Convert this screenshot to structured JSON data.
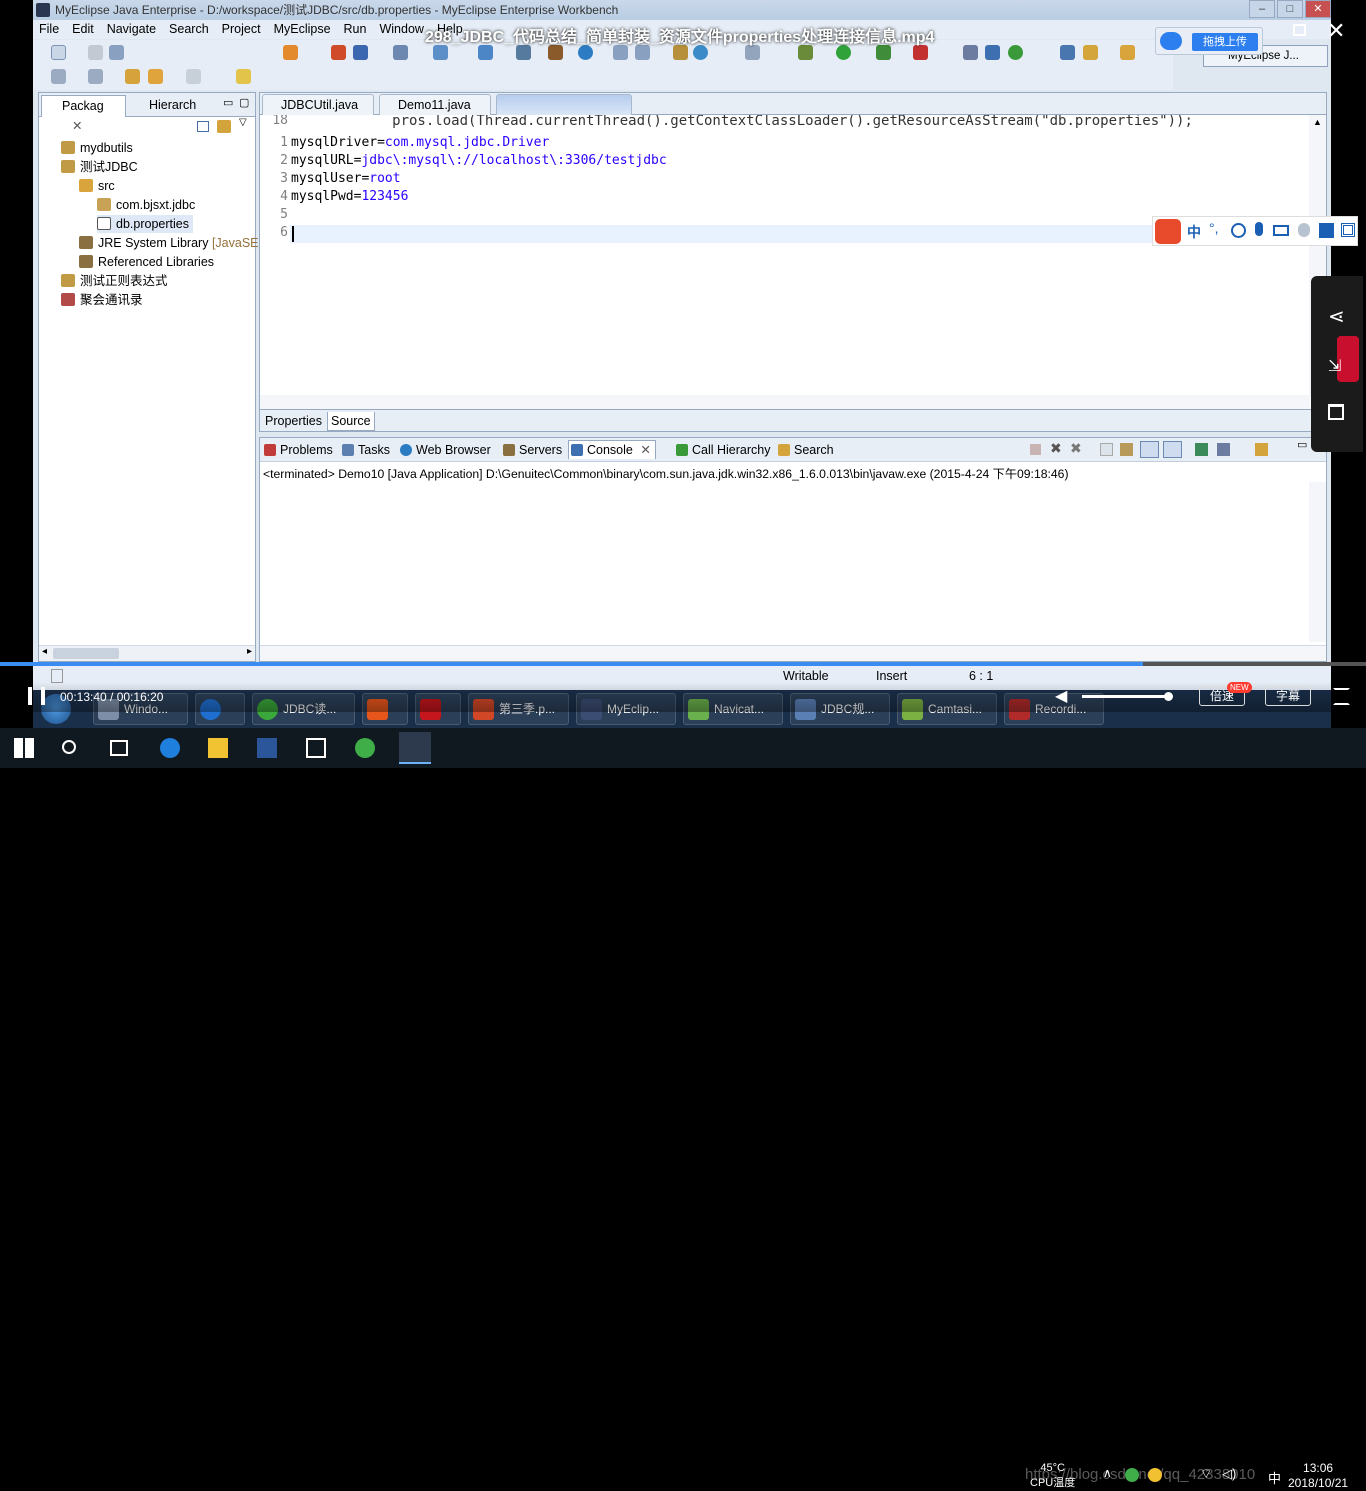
{
  "video": {
    "title": "298_JDBC_代码总结_简单封装_资源文件properties处理连接信息.mp4",
    "time": "00:13:40 / 00:16:20",
    "progress": 0.837,
    "speed_label": "倍速",
    "speed_badge": "NEW",
    "subtitle_label": "字幕",
    "upload_label": "拖拽上传"
  },
  "window": {
    "title": "MyEclipse Java Enterprise - D:/workspace/测试JDBC/src/db.properties - MyEclipse Enterprise Workbench",
    "perspective": "MyEclipse J..."
  },
  "menu": [
    "File",
    "Edit",
    "Navigate",
    "Search",
    "Project",
    "MyEclipse",
    "Run",
    "Window",
    "Help"
  ],
  "left_panel": {
    "tabs": [
      "Packag",
      "Hierarch"
    ],
    "tree": [
      {
        "label": "mydbutils",
        "level": 1
      },
      {
        "label": "测试JDBC",
        "level": 1
      },
      {
        "label": "src",
        "level": 2
      },
      {
        "label": "com.bjsxt.jdbc",
        "level": 3
      },
      {
        "label": "db.properties",
        "level": 3
      },
      {
        "label": "JRE System Library",
        "suffix": "[JavaSE-",
        "level": 2
      },
      {
        "label": "Referenced Libraries",
        "level": 2
      },
      {
        "label": "测试正则表达式",
        "level": 1
      },
      {
        "label": "聚会通讯录",
        "level": 1
      }
    ]
  },
  "editor": {
    "tabs": [
      "JDBCUtil.java",
      "Demo11.java"
    ],
    "ghost_line_no": "18",
    "ghost_line": "            pros.load(Thread.currentThread().getContextClassLoader().getResourceAsStream(\"db.properties\"));",
    "lines": [
      {
        "no": "1",
        "key": "mysqlDriver",
        "value": "com.mysql.jdbc.Driver"
      },
      {
        "no": "2",
        "key": "mysqlURL",
        "value": "jdbc\\:mysql\\://localhost\\:3306/testjdbc"
      },
      {
        "no": "3",
        "key": "mysqlUser",
        "value": "root"
      },
      {
        "no": "4",
        "key": "mysqlPwd",
        "value": "123456"
      },
      {
        "no": "5",
        "key": "",
        "value": ""
      },
      {
        "no": "6",
        "key": "",
        "value": ""
      }
    ],
    "bottom_tabs": [
      "Properties",
      "Source"
    ]
  },
  "console": {
    "tabs": [
      "Problems",
      "Tasks",
      "Web Browser",
      "Servers",
      "Console",
      "Call Hierarchy",
      "Search"
    ],
    "message": "<terminated> Demo10 [Java Application] D:\\Genuitec\\Common\\binary\\com.sun.java.jdk.win32.x86_1.6.0.013\\bin\\javaw.exe (2015-4-24 下午09:18:46)"
  },
  "status": {
    "writable": "Writable",
    "insert": "Insert",
    "position": "6 : 1"
  },
  "old_taskbar": [
    {
      "label": "Windo...",
      "color": "#7d8ea8"
    },
    {
      "label": "",
      "color": "#1f6fd1"
    },
    {
      "label": "JDBC读...",
      "color": "#3aa83a"
    },
    {
      "label": "",
      "color": "#e8561b"
    },
    {
      "label": "",
      "color": "#c4161c"
    },
    {
      "label": "第三季.p...",
      "color": "#d24726"
    },
    {
      "label": "MyEclip...",
      "color": "#3b4d73"
    },
    {
      "label": "Navicat...",
      "color": "#6ab04c"
    },
    {
      "label": "JDBC规...",
      "color": "#5a7fb5"
    },
    {
      "label": "Camtasi...",
      "color": "#7bb043"
    },
    {
      "label": "Recordi...",
      "color": "#b12b2b"
    }
  ],
  "system": {
    "temp": "45°C",
    "cpu_label": "CPU温度",
    "ime": "中",
    "time": "13:06",
    "date": "2018/10/21",
    "watermark": "https://blog.csdn.net/qq_42338010"
  }
}
